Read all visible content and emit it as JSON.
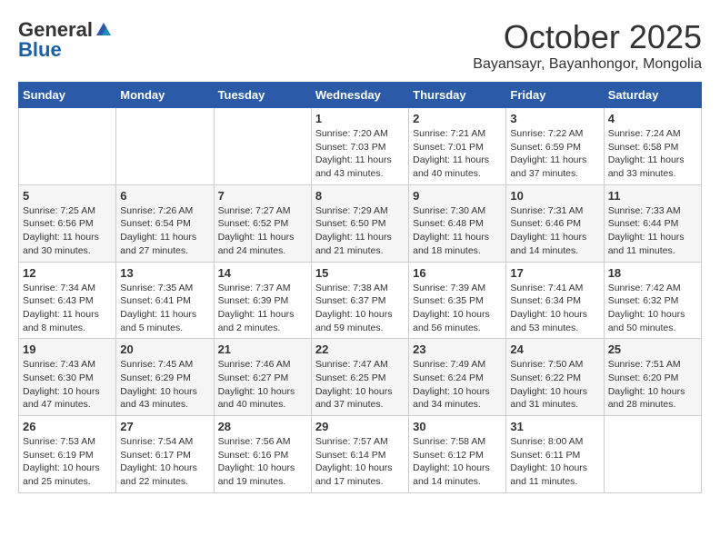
{
  "header": {
    "logo_general": "General",
    "logo_blue": "Blue",
    "month_title": "October 2025",
    "location": "Bayansayr, Bayanhongor, Mongolia"
  },
  "weekdays": [
    "Sunday",
    "Monday",
    "Tuesday",
    "Wednesday",
    "Thursday",
    "Friday",
    "Saturday"
  ],
  "weeks": [
    [
      {
        "day": "",
        "info": ""
      },
      {
        "day": "",
        "info": ""
      },
      {
        "day": "",
        "info": ""
      },
      {
        "day": "1",
        "info": "Sunrise: 7:20 AM\nSunset: 7:03 PM\nDaylight: 11 hours\nand 43 minutes."
      },
      {
        "day": "2",
        "info": "Sunrise: 7:21 AM\nSunset: 7:01 PM\nDaylight: 11 hours\nand 40 minutes."
      },
      {
        "day": "3",
        "info": "Sunrise: 7:22 AM\nSunset: 6:59 PM\nDaylight: 11 hours\nand 37 minutes."
      },
      {
        "day": "4",
        "info": "Sunrise: 7:24 AM\nSunset: 6:58 PM\nDaylight: 11 hours\nand 33 minutes."
      }
    ],
    [
      {
        "day": "5",
        "info": "Sunrise: 7:25 AM\nSunset: 6:56 PM\nDaylight: 11 hours\nand 30 minutes."
      },
      {
        "day": "6",
        "info": "Sunrise: 7:26 AM\nSunset: 6:54 PM\nDaylight: 11 hours\nand 27 minutes."
      },
      {
        "day": "7",
        "info": "Sunrise: 7:27 AM\nSunset: 6:52 PM\nDaylight: 11 hours\nand 24 minutes."
      },
      {
        "day": "8",
        "info": "Sunrise: 7:29 AM\nSunset: 6:50 PM\nDaylight: 11 hours\nand 21 minutes."
      },
      {
        "day": "9",
        "info": "Sunrise: 7:30 AM\nSunset: 6:48 PM\nDaylight: 11 hours\nand 18 minutes."
      },
      {
        "day": "10",
        "info": "Sunrise: 7:31 AM\nSunset: 6:46 PM\nDaylight: 11 hours\nand 14 minutes."
      },
      {
        "day": "11",
        "info": "Sunrise: 7:33 AM\nSunset: 6:44 PM\nDaylight: 11 hours\nand 11 minutes."
      }
    ],
    [
      {
        "day": "12",
        "info": "Sunrise: 7:34 AM\nSunset: 6:43 PM\nDaylight: 11 hours\nand 8 minutes."
      },
      {
        "day": "13",
        "info": "Sunrise: 7:35 AM\nSunset: 6:41 PM\nDaylight: 11 hours\nand 5 minutes."
      },
      {
        "day": "14",
        "info": "Sunrise: 7:37 AM\nSunset: 6:39 PM\nDaylight: 11 hours\nand 2 minutes."
      },
      {
        "day": "15",
        "info": "Sunrise: 7:38 AM\nSunset: 6:37 PM\nDaylight: 10 hours\nand 59 minutes."
      },
      {
        "day": "16",
        "info": "Sunrise: 7:39 AM\nSunset: 6:35 PM\nDaylight: 10 hours\nand 56 minutes."
      },
      {
        "day": "17",
        "info": "Sunrise: 7:41 AM\nSunset: 6:34 PM\nDaylight: 10 hours\nand 53 minutes."
      },
      {
        "day": "18",
        "info": "Sunrise: 7:42 AM\nSunset: 6:32 PM\nDaylight: 10 hours\nand 50 minutes."
      }
    ],
    [
      {
        "day": "19",
        "info": "Sunrise: 7:43 AM\nSunset: 6:30 PM\nDaylight: 10 hours\nand 47 minutes."
      },
      {
        "day": "20",
        "info": "Sunrise: 7:45 AM\nSunset: 6:29 PM\nDaylight: 10 hours\nand 43 minutes."
      },
      {
        "day": "21",
        "info": "Sunrise: 7:46 AM\nSunset: 6:27 PM\nDaylight: 10 hours\nand 40 minutes."
      },
      {
        "day": "22",
        "info": "Sunrise: 7:47 AM\nSunset: 6:25 PM\nDaylight: 10 hours\nand 37 minutes."
      },
      {
        "day": "23",
        "info": "Sunrise: 7:49 AM\nSunset: 6:24 PM\nDaylight: 10 hours\nand 34 minutes."
      },
      {
        "day": "24",
        "info": "Sunrise: 7:50 AM\nSunset: 6:22 PM\nDaylight: 10 hours\nand 31 minutes."
      },
      {
        "day": "25",
        "info": "Sunrise: 7:51 AM\nSunset: 6:20 PM\nDaylight: 10 hours\nand 28 minutes."
      }
    ],
    [
      {
        "day": "26",
        "info": "Sunrise: 7:53 AM\nSunset: 6:19 PM\nDaylight: 10 hours\nand 25 minutes."
      },
      {
        "day": "27",
        "info": "Sunrise: 7:54 AM\nSunset: 6:17 PM\nDaylight: 10 hours\nand 22 minutes."
      },
      {
        "day": "28",
        "info": "Sunrise: 7:56 AM\nSunset: 6:16 PM\nDaylight: 10 hours\nand 19 minutes."
      },
      {
        "day": "29",
        "info": "Sunrise: 7:57 AM\nSunset: 6:14 PM\nDaylight: 10 hours\nand 17 minutes."
      },
      {
        "day": "30",
        "info": "Sunrise: 7:58 AM\nSunset: 6:12 PM\nDaylight: 10 hours\nand 14 minutes."
      },
      {
        "day": "31",
        "info": "Sunrise: 8:00 AM\nSunset: 6:11 PM\nDaylight: 10 hours\nand 11 minutes."
      },
      {
        "day": "",
        "info": ""
      }
    ]
  ]
}
